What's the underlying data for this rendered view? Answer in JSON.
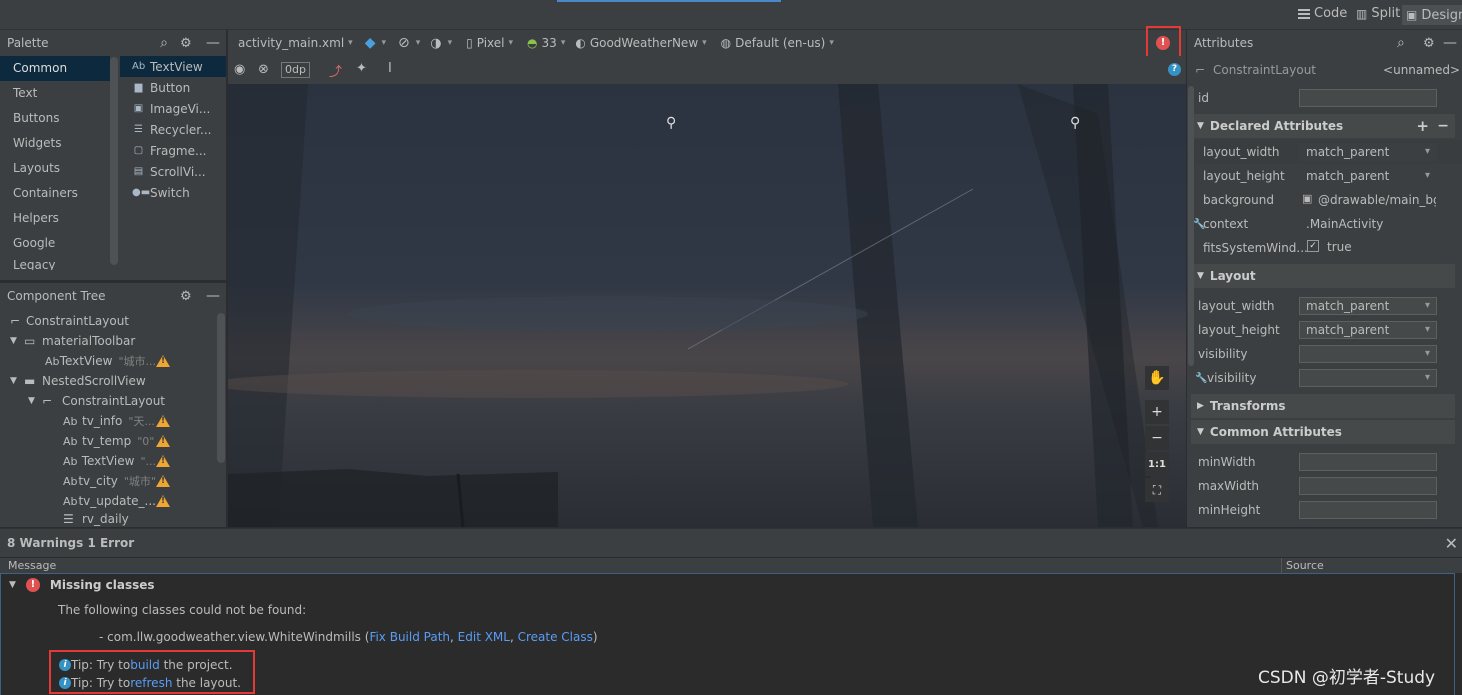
{
  "view_switch": {
    "code": "Code",
    "split": "Split",
    "design": "Design"
  },
  "palette": {
    "title": "Palette",
    "categories": [
      "Common",
      "Text",
      "Buttons",
      "Widgets",
      "Layouts",
      "Containers",
      "Helpers",
      "Google",
      "Legacy"
    ],
    "widgets": [
      {
        "icon": "Ab",
        "label": "TextView"
      },
      {
        "icon": "▆",
        "label": "Button"
      },
      {
        "icon": "▣",
        "label": "ImageVi..."
      },
      {
        "icon": "☰",
        "label": "Recycler..."
      },
      {
        "icon": "▢",
        "label": "Fragme..."
      },
      {
        "icon": "▤",
        "label": "ScrollVi..."
      },
      {
        "icon": "●▬",
        "label": "Switch"
      }
    ]
  },
  "component_tree": {
    "title": "Component Tree",
    "items": [
      {
        "icon": "⌐",
        "label": "ConstraintLayout",
        "hint": ""
      },
      {
        "icon": "▭",
        "label": "materialToolbar",
        "hint": ""
      },
      {
        "icon": "Ab",
        "label": "TextView",
        "hint": "\"城市..."
      },
      {
        "icon": "▬",
        "label": "NestedScrollView",
        "hint": ""
      },
      {
        "icon": "⌐",
        "label": "ConstraintLayout",
        "hint": ""
      },
      {
        "icon": "Ab",
        "label": "tv_info",
        "hint": "\"天..."
      },
      {
        "icon": "Ab",
        "label": "tv_temp",
        "hint": "\"0\""
      },
      {
        "icon": "Ab",
        "label": "TextView",
        "hint": "\"..."
      },
      {
        "icon": "Ab",
        "label": "tv_city",
        "hint": "\"城市\""
      },
      {
        "icon": "Ab",
        "label": "tv_update_...",
        "hint": ""
      },
      {
        "icon": "☰",
        "label": "rv_daily",
        "hint": ""
      }
    ]
  },
  "design_toolbar": {
    "file": "activity_main.xml",
    "device": "Pixel",
    "api": "33",
    "theme": "GoodWeatherNew",
    "locale": "Default (en-us)",
    "margin": "0dp"
  },
  "zoom_controls": {
    "fit": "1:1"
  },
  "attributes": {
    "title": "Attributes",
    "class": "ConstraintLayout",
    "class_value": "<unnamed>",
    "id_label": "id",
    "id_value": "",
    "declared_title": "Declared Attributes",
    "declared": [
      {
        "name": "layout_width",
        "value": "match_parent"
      },
      {
        "name": "layout_height",
        "value": "match_parent"
      },
      {
        "name": "background",
        "value": "@drawable/main_bg"
      },
      {
        "name": "context",
        "value": ".MainActivity"
      },
      {
        "name": "fitsSystemWind...",
        "value": "true"
      }
    ],
    "layout_title": "Layout",
    "layout": [
      {
        "name": "layout_width",
        "value": "match_parent"
      },
      {
        "name": "layout_height",
        "value": "match_parent"
      },
      {
        "name": "visibility",
        "value": ""
      },
      {
        "name": "visibility",
        "value": ""
      }
    ],
    "transforms_title": "Transforms",
    "common_title": "Common Attributes",
    "common": [
      {
        "name": "minWidth",
        "value": ""
      },
      {
        "name": "maxWidth",
        "value": ""
      },
      {
        "name": "minHeight",
        "value": ""
      }
    ]
  },
  "issues": {
    "summary": "8 Warnings 1 Error",
    "col_message": "Message",
    "col_source": "Source",
    "error_title": "Missing classes",
    "error_desc": "The following classes could not be found:",
    "missing_class": "- com.llw.goodweather.view.WhiteWindmills (",
    "link_fix": "Fix Build Path",
    "link_edit": "Edit XML",
    "link_create": "Create Class",
    "tip1_prefix": "Tip: Try to ",
    "tip1_link": "build",
    "tip1_suffix": " the project.",
    "tip2_prefix": "Tip: Try to ",
    "tip2_link": "refresh",
    "tip2_suffix": " the layout."
  },
  "watermark": "CSDN @初学者-Study"
}
